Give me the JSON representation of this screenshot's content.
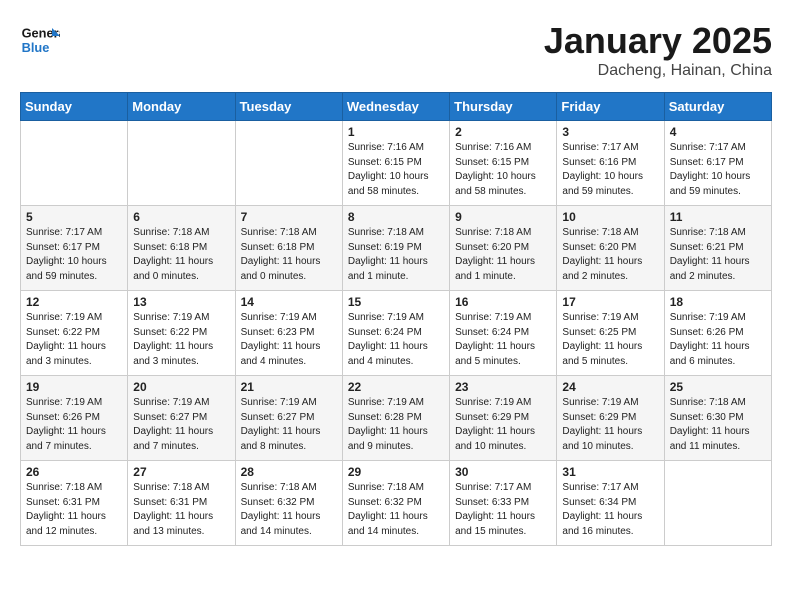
{
  "header": {
    "logo_line1": "General",
    "logo_line2": "Blue",
    "month": "January 2025",
    "location": "Dacheng, Hainan, China"
  },
  "weekdays": [
    "Sunday",
    "Monday",
    "Tuesday",
    "Wednesday",
    "Thursday",
    "Friday",
    "Saturday"
  ],
  "weeks": [
    [
      {
        "day": "",
        "sunrise": "",
        "sunset": "",
        "daylight": ""
      },
      {
        "day": "",
        "sunrise": "",
        "sunset": "",
        "daylight": ""
      },
      {
        "day": "",
        "sunrise": "",
        "sunset": "",
        "daylight": ""
      },
      {
        "day": "1",
        "sunrise": "Sunrise: 7:16 AM",
        "sunset": "Sunset: 6:15 PM",
        "daylight": "Daylight: 10 hours and 58 minutes."
      },
      {
        "day": "2",
        "sunrise": "Sunrise: 7:16 AM",
        "sunset": "Sunset: 6:15 PM",
        "daylight": "Daylight: 10 hours and 58 minutes."
      },
      {
        "day": "3",
        "sunrise": "Sunrise: 7:17 AM",
        "sunset": "Sunset: 6:16 PM",
        "daylight": "Daylight: 10 hours and 59 minutes."
      },
      {
        "day": "4",
        "sunrise": "Sunrise: 7:17 AM",
        "sunset": "Sunset: 6:17 PM",
        "daylight": "Daylight: 10 hours and 59 minutes."
      }
    ],
    [
      {
        "day": "5",
        "sunrise": "Sunrise: 7:17 AM",
        "sunset": "Sunset: 6:17 PM",
        "daylight": "Daylight: 10 hours and 59 minutes."
      },
      {
        "day": "6",
        "sunrise": "Sunrise: 7:18 AM",
        "sunset": "Sunset: 6:18 PM",
        "daylight": "Daylight: 11 hours and 0 minutes."
      },
      {
        "day": "7",
        "sunrise": "Sunrise: 7:18 AM",
        "sunset": "Sunset: 6:18 PM",
        "daylight": "Daylight: 11 hours and 0 minutes."
      },
      {
        "day": "8",
        "sunrise": "Sunrise: 7:18 AM",
        "sunset": "Sunset: 6:19 PM",
        "daylight": "Daylight: 11 hours and 1 minute."
      },
      {
        "day": "9",
        "sunrise": "Sunrise: 7:18 AM",
        "sunset": "Sunset: 6:20 PM",
        "daylight": "Daylight: 11 hours and 1 minute."
      },
      {
        "day": "10",
        "sunrise": "Sunrise: 7:18 AM",
        "sunset": "Sunset: 6:20 PM",
        "daylight": "Daylight: 11 hours and 2 minutes."
      },
      {
        "day": "11",
        "sunrise": "Sunrise: 7:18 AM",
        "sunset": "Sunset: 6:21 PM",
        "daylight": "Daylight: 11 hours and 2 minutes."
      }
    ],
    [
      {
        "day": "12",
        "sunrise": "Sunrise: 7:19 AM",
        "sunset": "Sunset: 6:22 PM",
        "daylight": "Daylight: 11 hours and 3 minutes."
      },
      {
        "day": "13",
        "sunrise": "Sunrise: 7:19 AM",
        "sunset": "Sunset: 6:22 PM",
        "daylight": "Daylight: 11 hours and 3 minutes."
      },
      {
        "day": "14",
        "sunrise": "Sunrise: 7:19 AM",
        "sunset": "Sunset: 6:23 PM",
        "daylight": "Daylight: 11 hours and 4 minutes."
      },
      {
        "day": "15",
        "sunrise": "Sunrise: 7:19 AM",
        "sunset": "Sunset: 6:24 PM",
        "daylight": "Daylight: 11 hours and 4 minutes."
      },
      {
        "day": "16",
        "sunrise": "Sunrise: 7:19 AM",
        "sunset": "Sunset: 6:24 PM",
        "daylight": "Daylight: 11 hours and 5 minutes."
      },
      {
        "day": "17",
        "sunrise": "Sunrise: 7:19 AM",
        "sunset": "Sunset: 6:25 PM",
        "daylight": "Daylight: 11 hours and 5 minutes."
      },
      {
        "day": "18",
        "sunrise": "Sunrise: 7:19 AM",
        "sunset": "Sunset: 6:26 PM",
        "daylight": "Daylight: 11 hours and 6 minutes."
      }
    ],
    [
      {
        "day": "19",
        "sunrise": "Sunrise: 7:19 AM",
        "sunset": "Sunset: 6:26 PM",
        "daylight": "Daylight: 11 hours and 7 minutes."
      },
      {
        "day": "20",
        "sunrise": "Sunrise: 7:19 AM",
        "sunset": "Sunset: 6:27 PM",
        "daylight": "Daylight: 11 hours and 7 minutes."
      },
      {
        "day": "21",
        "sunrise": "Sunrise: 7:19 AM",
        "sunset": "Sunset: 6:27 PM",
        "daylight": "Daylight: 11 hours and 8 minutes."
      },
      {
        "day": "22",
        "sunrise": "Sunrise: 7:19 AM",
        "sunset": "Sunset: 6:28 PM",
        "daylight": "Daylight: 11 hours and 9 minutes."
      },
      {
        "day": "23",
        "sunrise": "Sunrise: 7:19 AM",
        "sunset": "Sunset: 6:29 PM",
        "daylight": "Daylight: 11 hours and 10 minutes."
      },
      {
        "day": "24",
        "sunrise": "Sunrise: 7:19 AM",
        "sunset": "Sunset: 6:29 PM",
        "daylight": "Daylight: 11 hours and 10 minutes."
      },
      {
        "day": "25",
        "sunrise": "Sunrise: 7:18 AM",
        "sunset": "Sunset: 6:30 PM",
        "daylight": "Daylight: 11 hours and 11 minutes."
      }
    ],
    [
      {
        "day": "26",
        "sunrise": "Sunrise: 7:18 AM",
        "sunset": "Sunset: 6:31 PM",
        "daylight": "Daylight: 11 hours and 12 minutes."
      },
      {
        "day": "27",
        "sunrise": "Sunrise: 7:18 AM",
        "sunset": "Sunset: 6:31 PM",
        "daylight": "Daylight: 11 hours and 13 minutes."
      },
      {
        "day": "28",
        "sunrise": "Sunrise: 7:18 AM",
        "sunset": "Sunset: 6:32 PM",
        "daylight": "Daylight: 11 hours and 14 minutes."
      },
      {
        "day": "29",
        "sunrise": "Sunrise: 7:18 AM",
        "sunset": "Sunset: 6:32 PM",
        "daylight": "Daylight: 11 hours and 14 minutes."
      },
      {
        "day": "30",
        "sunrise": "Sunrise: 7:17 AM",
        "sunset": "Sunset: 6:33 PM",
        "daylight": "Daylight: 11 hours and 15 minutes."
      },
      {
        "day": "31",
        "sunrise": "Sunrise: 7:17 AM",
        "sunset": "Sunset: 6:34 PM",
        "daylight": "Daylight: 11 hours and 16 minutes."
      },
      {
        "day": "",
        "sunrise": "",
        "sunset": "",
        "daylight": ""
      }
    ]
  ]
}
